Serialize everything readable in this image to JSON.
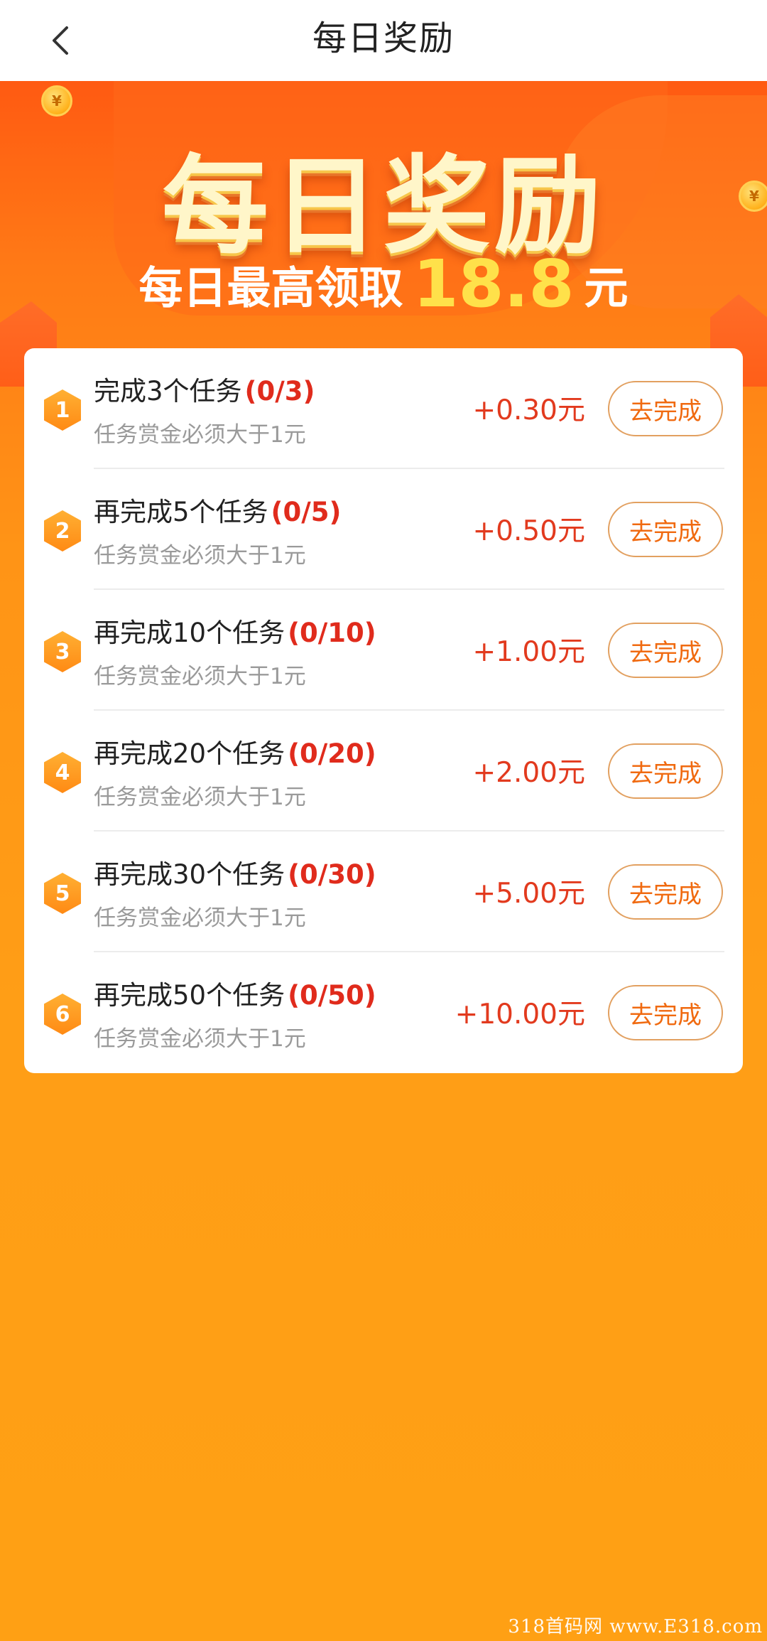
{
  "header": {
    "title": "每日奖励"
  },
  "banner": {
    "title": "每日奖励",
    "subtitle_lead": "每日最高领取",
    "subtitle_amount": "18.8",
    "subtitle_unit": "元",
    "coin_symbol": "¥"
  },
  "tasks": [
    {
      "index": "1",
      "title": "完成3个任务",
      "progress": "(0/3)",
      "subtitle": "任务赏金必须大于1元",
      "reward": "+0.30元",
      "button": "去完成"
    },
    {
      "index": "2",
      "title": "再完成5个任务",
      "progress": "(0/5)",
      "subtitle": "任务赏金必须大于1元",
      "reward": "+0.50元",
      "button": "去完成"
    },
    {
      "index": "3",
      "title": "再完成10个任务",
      "progress": "(0/10)",
      "subtitle": "任务赏金必须大于1元",
      "reward": "+1.00元",
      "button": "去完成"
    },
    {
      "index": "4",
      "title": "再完成20个任务",
      "progress": "(0/20)",
      "subtitle": "任务赏金必须大于1元",
      "reward": "+2.00元",
      "button": "去完成"
    },
    {
      "index": "5",
      "title": "再完成30个任务",
      "progress": "(0/30)",
      "subtitle": "任务赏金必须大于1元",
      "reward": "+5.00元",
      "button": "去完成"
    },
    {
      "index": "6",
      "title": "再完成50个任务",
      "progress": "(0/50)",
      "subtitle": "任务赏金必须大于1元",
      "reward": "+10.00元",
      "button": "去完成"
    }
  ],
  "watermark": "318首码网 www.E318.com",
  "colors": {
    "accent_red": "#e02b1c",
    "reward_red": "#e23a1e",
    "button_orange": "#f06a10",
    "banner_yellow": "#ffe14a"
  }
}
